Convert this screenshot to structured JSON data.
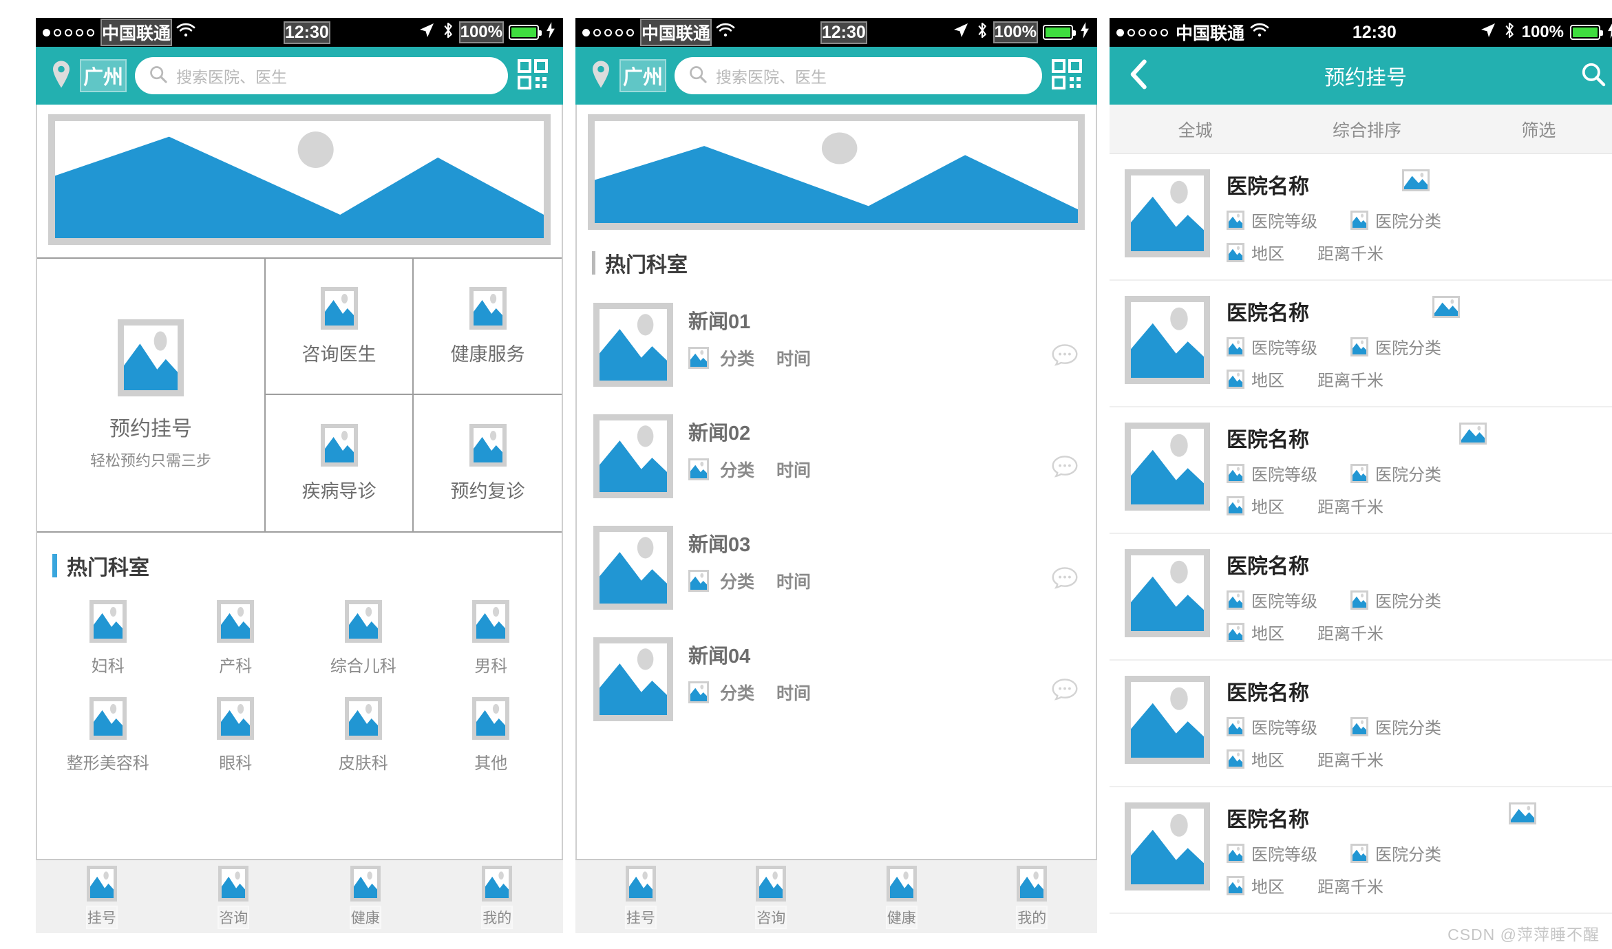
{
  "statusbar": {
    "carrier": "中国联通",
    "time": "12:30",
    "battery_pct": "100%",
    "signal_dots_filled": 1,
    "signal_dots_total": 5,
    "icons": [
      "wifi-icon",
      "location-arrow-icon",
      "bluetooth-icon",
      "battery-icon",
      "charging-bolt-icon"
    ]
  },
  "home": {
    "appbar": {
      "city": "广州",
      "search_placeholder": "搜索医院、医生",
      "search_value": "",
      "qr_icon": "qr-code-icon",
      "pin_icon": "location-pin-icon",
      "search_icon": "search-icon"
    },
    "features": {
      "main": {
        "label": "预约挂号",
        "sublabel": "轻松预约只需三步"
      },
      "cells": [
        {
          "label": "咨询医生"
        },
        {
          "label": "健康服务"
        },
        {
          "label": "疾病导诊"
        },
        {
          "label": "预约复诊"
        }
      ]
    },
    "departments_section_title": "热门科室",
    "departments": [
      {
        "label": "妇科"
      },
      {
        "label": "产科"
      },
      {
        "label": "综合儿科"
      },
      {
        "label": "男科"
      },
      {
        "label": "整形美容科"
      },
      {
        "label": "眼科"
      },
      {
        "label": "皮肤科"
      },
      {
        "label": "其他"
      }
    ],
    "tabbar": [
      {
        "label": "挂号"
      },
      {
        "label": "咨询"
      },
      {
        "label": "健康"
      },
      {
        "label": "我的"
      }
    ]
  },
  "news": {
    "appbar": {
      "city": "广州",
      "search_placeholder": "搜索医院、医生",
      "search_value": ""
    },
    "section_title": "热门科室",
    "items": [
      {
        "title": "新闻01",
        "category": "分类",
        "time": "时间"
      },
      {
        "title": "新闻02",
        "category": "分类",
        "time": "时间"
      },
      {
        "title": "新闻03",
        "category": "分类",
        "time": "时间"
      },
      {
        "title": "新闻04",
        "category": "分类",
        "time": "时间"
      }
    ],
    "tabbar": [
      {
        "label": "挂号"
      },
      {
        "label": "咨询"
      },
      {
        "label": "健康"
      },
      {
        "label": "我的"
      }
    ]
  },
  "hospitals": {
    "navbar": {
      "title": "预约挂号",
      "back_icon": "back-chevron-icon",
      "search_icon": "search-icon"
    },
    "filters": [
      {
        "label": "全城"
      },
      {
        "label": "综合排序"
      },
      {
        "label": "筛选"
      }
    ],
    "rows": [
      {
        "name": "医院名称",
        "level": "医院等级",
        "category": "医院分类",
        "area": "地区",
        "distance": "距离千米",
        "badge_left_pct": 46
      },
      {
        "name": "医院名称",
        "level": "医院等级",
        "category": "医院分类",
        "area": "地区",
        "distance": "距离千米",
        "badge_left_pct": 54
      },
      {
        "name": "医院名称",
        "level": "医院等级",
        "category": "医院分类",
        "area": "地区",
        "distance": "距离千米",
        "badge_left_pct": 61
      },
      {
        "name": "医院名称",
        "level": "医院等级",
        "category": "医院分类",
        "area": "地区",
        "distance": "距离千米",
        "badge_left_pct": 0
      },
      {
        "name": "医院名称",
        "level": "医院等级",
        "category": "医院分类",
        "area": "地区",
        "distance": "距离千米",
        "badge_left_pct": 0
      },
      {
        "name": "医院名称",
        "level": "医院等级",
        "category": "医院分类",
        "area": "地区",
        "distance": "距离千米",
        "badge_left_pct": 74
      }
    ]
  },
  "watermark": "CSDN @萍萍睡不醒",
  "colors": {
    "accent_teal": "#23b0b0",
    "placeholder_blue": "#2196d3",
    "placeholder_gray": "#cfcfcf",
    "battery_green": "#3fdd3f"
  }
}
